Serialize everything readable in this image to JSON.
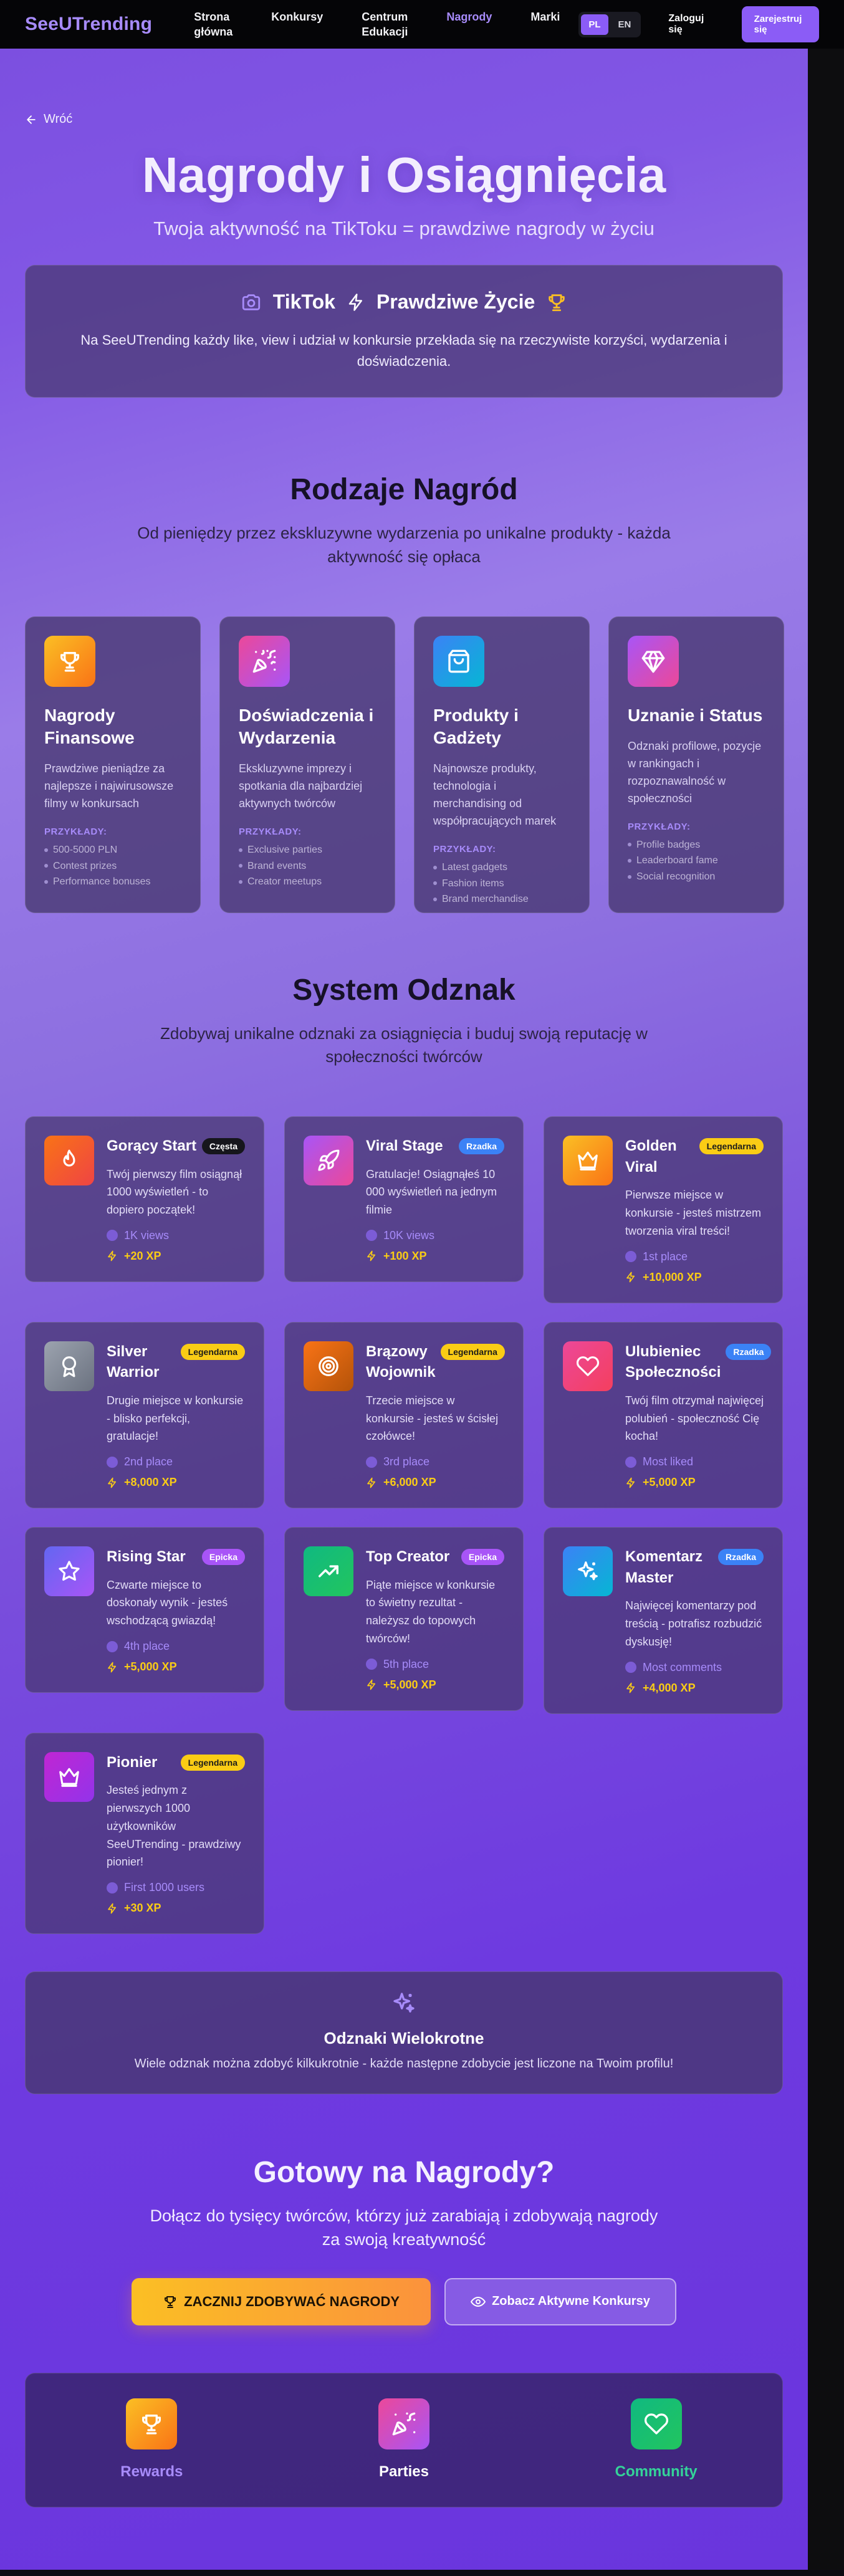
{
  "nav": {
    "brand": "SeeUTrending",
    "links": [
      {
        "label": "Strona główna"
      },
      {
        "label": "Konkursy"
      },
      {
        "label": "Centrum Edukacji"
      },
      {
        "label": "Nagrody"
      },
      {
        "label": "Marki"
      }
    ],
    "lang": [
      "PL",
      "EN"
    ],
    "login": "Zaloguj się",
    "register": "Zarejestruj się"
  },
  "back": "Wróć",
  "hero": {
    "title": "Nagrody i Osiągnięcia",
    "subtitle": "Twoja aktywność na TikToku = prawdziwe nagrody w życiu"
  },
  "intro": {
    "left": "TikTok",
    "right": "Prawdziwe Życie",
    "text": "Na SeeUTrending każdy like, view i udział w konkursie przekłada się na rzeczywiste korzyści, wydarzenia i doświadczenia."
  },
  "rewards_section": {
    "title": "Rodzaje Nagród",
    "subtitle": "Od pieniędzy przez ekskluzywne wydarzenia po unikalne produkty - każda aktywność się opłaca",
    "examples_label": "PRZYKŁADY:",
    "cards": [
      {
        "title": "Nagrody Finansowe",
        "desc": "Prawdziwe pieniądze za najlepsze i najwirusowsze filmy w konkursach",
        "examples": [
          "500-5000 PLN",
          "Contest prizes",
          "Performance bonuses"
        ]
      },
      {
        "title": "Doświadczenia i Wydarzenia",
        "desc": "Ekskluzywne imprezy i spotkania dla najbardziej aktywnych twórców",
        "examples": [
          "Exclusive parties",
          "Brand events",
          "Creator meetups"
        ]
      },
      {
        "title": "Produkty i Gadżety",
        "desc": "Najnowsze produkty, technologia i merchandising od współpracujących marek",
        "examples": [
          "Latest gadgets",
          "Fashion items",
          "Brand merchandise"
        ]
      },
      {
        "title": "Uznanie i Status",
        "desc": "Odznaki profilowe, pozycje w rankingach i rozpoznawalność w społeczności",
        "examples": [
          "Profile badges",
          "Leaderboard fame",
          "Social recognition"
        ]
      }
    ]
  },
  "badges_section": {
    "title": "System Odznak",
    "subtitle": "Zdobywaj unikalne odznaki za osiągnięcia i buduj swoją reputację w społeczności twórców",
    "badges": [
      {
        "name": "Gorący Start",
        "rarity": "Częsta",
        "desc": "Twój pierwszy film osiągnął 1000 wyświetleń - to dopiero początek!",
        "req": "1K views",
        "xp": "+20 XP"
      },
      {
        "name": "Viral Stage",
        "rarity": "Rzadka",
        "desc": "Gratulacje! Osiągnąłeś 10 000 wyświetleń na jednym filmie",
        "req": "10K views",
        "xp": "+100 XP"
      },
      {
        "name": "Golden Viral",
        "rarity": "Legendarna",
        "desc": "Pierwsze miejsce w konkursie - jesteś mistrzem tworzenia viral treści!",
        "req": "1st place",
        "xp": "+10,000 XP"
      },
      {
        "name": "Silver Warrior",
        "rarity": "Legendarna",
        "desc": "Drugie miejsce w konkursie - blisko perfekcji, gratulacje!",
        "req": "2nd place",
        "xp": "+8,000 XP"
      },
      {
        "name": "Brązowy Wojownik",
        "rarity": "Legendarna",
        "desc": "Trzecie miejsce w konkursie - jesteś w ścisłej czołówce!",
        "req": "3rd place",
        "xp": "+6,000 XP"
      },
      {
        "name": "Ulubieniec Społeczności",
        "rarity": "Rzadka",
        "desc": "Twój film otrzymał najwięcej polubień - społeczność Cię kocha!",
        "req": "Most liked",
        "xp": "+5,000 XP"
      },
      {
        "name": "Rising Star",
        "rarity": "Epicka",
        "desc": "Czwarte miejsce to doskonały wynik - jesteś wschodzącą gwiazdą!",
        "req": "4th place",
        "xp": "+5,000 XP"
      },
      {
        "name": "Top Creator",
        "rarity": "Epicka",
        "desc": "Piąte miejsce w konkursie to świetny rezultat - należysz do topowych twórców!",
        "req": "5th place",
        "xp": "+5,000 XP"
      },
      {
        "name": "Komentarz Master",
        "rarity": "Rzadka",
        "desc": "Najwięcej komentarzy pod treścią - potrafisz rozbudzić dyskusję!",
        "req": "Most comments",
        "xp": "+4,000 XP"
      },
      {
        "name": "Pionier",
        "rarity": "Legendarna",
        "desc": "Jesteś jednym z pierwszych 1000 użytkowników SeeUTrending - prawdziwy pionier!",
        "req": "First 1000 users",
        "xp": "+30 XP"
      }
    ]
  },
  "multi": {
    "title": "Odznaki Wielokrotne",
    "text": "Wiele odznak można zdobyć kilkukrotnie - każde następne zdobycie jest liczone na Twoim profilu!"
  },
  "cta": {
    "title": "Gotowy na Nagrody?",
    "subtitle": "Dołącz do tysięcy twórców, którzy już zarabiają i zdobywają nagrody za swoją kreatywność",
    "primary": "ZACZNIJ ZDOBYWAĆ NAGRODY",
    "secondary": "Zobacz Aktywne Konkursy"
  },
  "bottom": [
    {
      "label": "Rewards",
      "color": "#a78bfa"
    },
    {
      "label": "Parties",
      "color": "#ffffff"
    },
    {
      "label": "Community",
      "color": "#34d399"
    }
  ]
}
